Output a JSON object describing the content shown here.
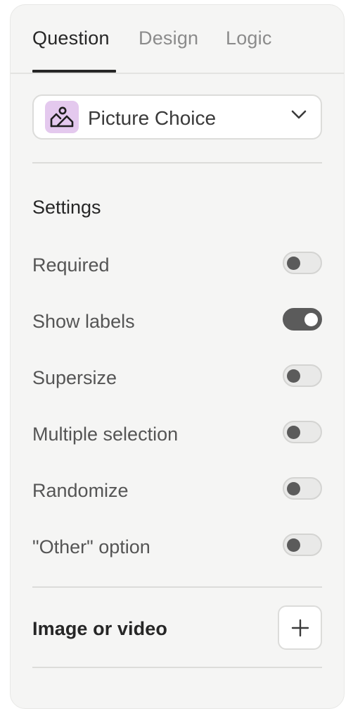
{
  "tabs": [
    {
      "label": "Question",
      "active": true
    },
    {
      "label": "Design",
      "active": false
    },
    {
      "label": "Logic",
      "active": false
    }
  ],
  "question_type": {
    "label": "Picture Choice",
    "icon": "picture-icon",
    "icon_bg": "#e4c9ee"
  },
  "settings": {
    "title": "Settings",
    "items": [
      {
        "label": "Required",
        "enabled": false
      },
      {
        "label": "Show labels",
        "enabled": true
      },
      {
        "label": "Supersize",
        "enabled": false
      },
      {
        "label": "Multiple selection",
        "enabled": false
      },
      {
        "label": "Randomize",
        "enabled": false
      },
      {
        "label": "\"Other\" option",
        "enabled": false
      }
    ]
  },
  "media": {
    "title": "Image or video",
    "add_icon": "plus-icon"
  }
}
